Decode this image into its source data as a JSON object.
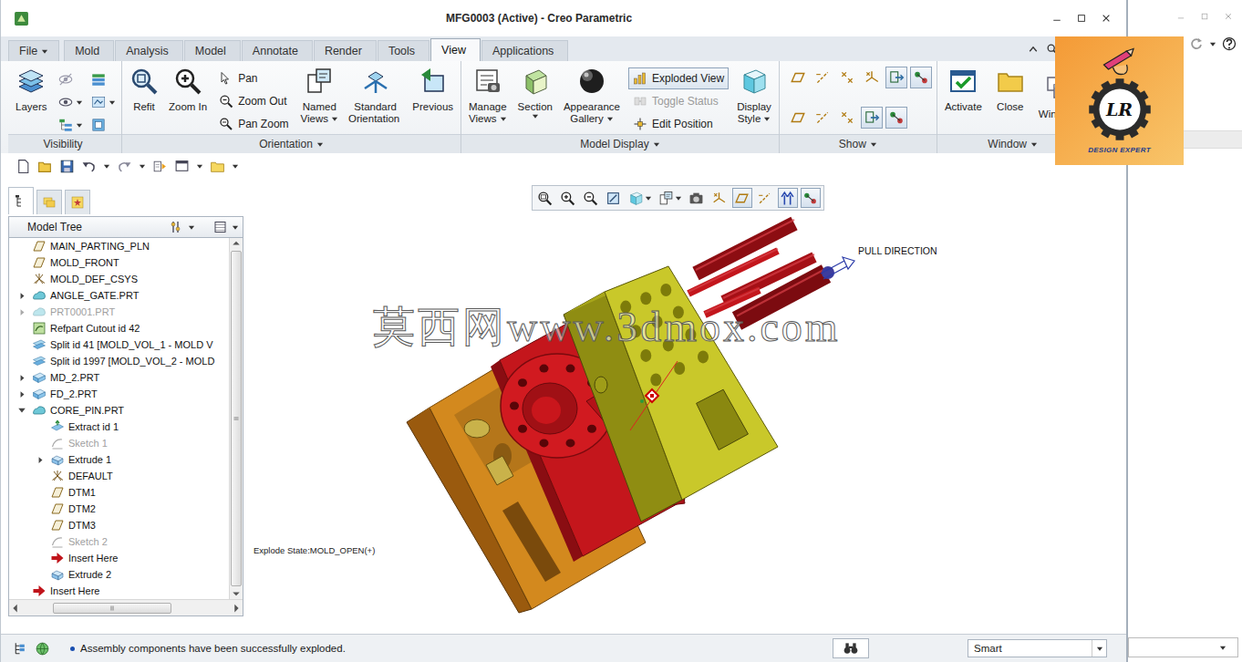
{
  "window": {
    "title": "MFG0003 (Active) - Creo Parametric"
  },
  "tabs": [
    {
      "label": "File",
      "selected": false,
      "dropdown": true
    },
    {
      "label": "Mold",
      "selected": false,
      "dropdown": false
    },
    {
      "label": "Analysis",
      "selected": false,
      "dropdown": false
    },
    {
      "label": "Model",
      "selected": false,
      "dropdown": false
    },
    {
      "label": "Annotate",
      "selected": false,
      "dropdown": false
    },
    {
      "label": "Render",
      "selected": false,
      "dropdown": false
    },
    {
      "label": "Tools",
      "selected": false,
      "dropdown": false
    },
    {
      "label": "View",
      "selected": true,
      "dropdown": false
    },
    {
      "label": "Applications",
      "selected": false,
      "dropdown": false
    }
  ],
  "ribbon": [
    {
      "label": "Visibility",
      "dropdown": false,
      "items": [
        {
          "kind": "large",
          "lines": [
            "Layers"
          ],
          "dropdown": false
        },
        {
          "kind": "column",
          "icons": [
            {
              "dropdown": false
            },
            {
              "dropdown": true
            },
            {
              "dropdown": true
            }
          ]
        },
        {
          "kind": "column",
          "icons": [
            {
              "dropdown": false
            },
            {
              "dropdown": true
            },
            {
              "dropdown": false
            }
          ]
        }
      ]
    },
    {
      "label": "Orientation",
      "dropdown": true,
      "items": [
        {
          "kind": "large",
          "lines": [
            "Refit"
          ],
          "dropdown": false
        },
        {
          "kind": "large",
          "lines": [
            "Zoom In"
          ],
          "dropdown": false
        },
        {
          "kind": "list",
          "rows": [
            {
              "label": "Pan",
              "pressed": false,
              "disabled": false
            },
            {
              "label": "Zoom Out",
              "pressed": false,
              "disabled": false
            },
            {
              "label": "Pan Zoom",
              "pressed": false,
              "disabled": false
            }
          ]
        },
        {
          "kind": "large",
          "lines": [
            "Named",
            "Views"
          ],
          "dropdown": true
        },
        {
          "kind": "large",
          "lines": [
            "Standard",
            "Orientation"
          ],
          "dropdown": false
        },
        {
          "kind": "large",
          "lines": [
            "Previous"
          ],
          "dropdown": false
        }
      ]
    },
    {
      "label": "Model Display",
      "dropdown": true,
      "items": [
        {
          "kind": "large",
          "lines": [
            "Manage",
            "Views"
          ],
          "dropdown": true
        },
        {
          "kind": "large",
          "lines": [
            "Section"
          ],
          "dropdown": true
        },
        {
          "kind": "large",
          "lines": [
            "Appearance",
            "Gallery"
          ],
          "dropdown": true
        },
        {
          "kind": "list",
          "rows": [
            {
              "label": "Exploded View",
              "pressed": true,
              "disabled": false
            },
            {
              "label": "Toggle Status",
              "pressed": false,
              "disabled": true
            },
            {
              "label": "Edit Position",
              "pressed": false,
              "disabled": false
            }
          ]
        },
        {
          "kind": "large",
          "lines": [
            "Display",
            "Style"
          ],
          "dropdown": true
        }
      ]
    },
    {
      "label": "Show",
      "dropdown": true,
      "items": [
        {
          "kind": "grid",
          "rows": [
            [
              {
                "pressed": false
              },
              {
                "pressed": false
              },
              {
                "pressed": false
              },
              {
                "pressed": false
              },
              {
                "pressed": true
              },
              {
                "pressed": true
              }
            ],
            [
              {
                "pressed": false
              },
              {
                "pressed": false
              },
              {
                "pressed": false
              },
              {
                "pressed": true
              },
              {
                "pressed": true
              }
            ]
          ]
        }
      ]
    },
    {
      "label": "Window",
      "dropdown": true,
      "items": [
        {
          "kind": "large",
          "lines": [
            "Activate"
          ],
          "dropdown": false
        },
        {
          "kind": "large",
          "lines": [
            "Close"
          ],
          "dropdown": false
        },
        {
          "kind": "large",
          "lines": [
            "Windows"
          ],
          "dropdown": true
        }
      ]
    }
  ],
  "graphics_toolbar": [
    {
      "pressed": false,
      "dropdown": false
    },
    {
      "pressed": false,
      "dropdown": false
    },
    {
      "pressed": false,
      "dropdown": false
    },
    {
      "pressed": false,
      "dropdown": false
    },
    {
      "pressed": false,
      "dropdown": true
    },
    {
      "pressed": false,
      "dropdown": true
    },
    {
      "pressed": false,
      "dropdown": false
    },
    {
      "pressed": false,
      "dropdown": false
    },
    {
      "pressed": true,
      "dropdown": false
    },
    {
      "pressed": false,
      "dropdown": false
    },
    {
      "pressed": true,
      "dropdown": false
    },
    {
      "pressed": true,
      "dropdown": false
    }
  ],
  "model_tree": {
    "title": "Model Tree",
    "tabs": [
      {
        "selected": true
      },
      {
        "selected": false
      },
      {
        "selected": false
      }
    ],
    "items": [
      {
        "label": "MAIN_PARTING_PLN",
        "kind": "plane",
        "depth": 0,
        "toggle": "none",
        "disabled": false
      },
      {
        "label": "MOLD_FRONT",
        "kind": "plane",
        "depth": 0,
        "toggle": "none",
        "disabled": false
      },
      {
        "label": "MOLD_DEF_CSYS",
        "kind": "csys",
        "depth": 0,
        "toggle": "none",
        "disabled": false
      },
      {
        "label": "ANGLE_GATE.PRT",
        "kind": "part",
        "depth": 0,
        "toggle": "collapsed",
        "disabled": false
      },
      {
        "label": "PRT0001.PRT",
        "kind": "part",
        "depth": 0,
        "toggle": "collapsed",
        "disabled": true
      },
      {
        "label": "Refpart Cutout id 42",
        "kind": "cutout",
        "depth": 0,
        "toggle": "none",
        "disabled": false
      },
      {
        "label": "Split id 41 [MOLD_VOL_1 - MOLD V",
        "kind": "split",
        "depth": 0,
        "toggle": "none",
        "disabled": false
      },
      {
        "label": "Split id 1997 [MOLD_VOL_2 - MOLD",
        "kind": "split",
        "depth": 0,
        "toggle": "none",
        "disabled": false
      },
      {
        "label": "MD_2.PRT",
        "kind": "volume",
        "depth": 0,
        "toggle": "collapsed",
        "disabled": false
      },
      {
        "label": "FD_2.PRT",
        "kind": "volume",
        "depth": 0,
        "toggle": "collapsed",
        "disabled": false
      },
      {
        "label": "CORE_PIN.PRT",
        "kind": "part",
        "depth": 0,
        "toggle": "expanded",
        "disabled": false
      },
      {
        "label": "Extract id 1",
        "kind": "extract",
        "depth": 1,
        "toggle": "none",
        "disabled": false
      },
      {
        "label": "Sketch 1",
        "kind": "sketch",
        "depth": 1,
        "toggle": "none",
        "disabled": true
      },
      {
        "label": "Extrude 1",
        "kind": "extrude",
        "depth": 1,
        "toggle": "collapsed",
        "disabled": false
      },
      {
        "label": "DEFAULT",
        "kind": "csys",
        "depth": 1,
        "toggle": "none",
        "disabled": false
      },
      {
        "label": "DTM1",
        "kind": "plane",
        "depth": 1,
        "toggle": "none",
        "disabled": false
      },
      {
        "label": "DTM2",
        "kind": "plane",
        "depth": 1,
        "toggle": "none",
        "disabled": false
      },
      {
        "label": "DTM3",
        "kind": "plane",
        "depth": 1,
        "toggle": "none",
        "disabled": false
      },
      {
        "label": "Sketch 2",
        "kind": "sketch",
        "depth": 1,
        "toggle": "none",
        "disabled": true
      },
      {
        "label": "Insert Here",
        "kind": "insert",
        "depth": 1,
        "toggle": "none",
        "disabled": false
      },
      {
        "label": "Extrude 2",
        "kind": "extrude",
        "depth": 1,
        "toggle": "none",
        "disabled": false
      },
      {
        "label": "Insert Here",
        "kind": "insert",
        "depth": 0,
        "toggle": "none",
        "disabled": false
      }
    ]
  },
  "canvas": {
    "watermark": "莫西网www.3dmox.com",
    "pull_direction": "PULL DIRECTION",
    "explode_state": "Explode State:MOLD_OPEN(+)"
  },
  "logo": {
    "monogram": "LR",
    "tagline": "DESIGN EXPERT"
  },
  "status_bar": {
    "message": "Assembly components have been successfully exploded.",
    "filter": "Smart"
  }
}
